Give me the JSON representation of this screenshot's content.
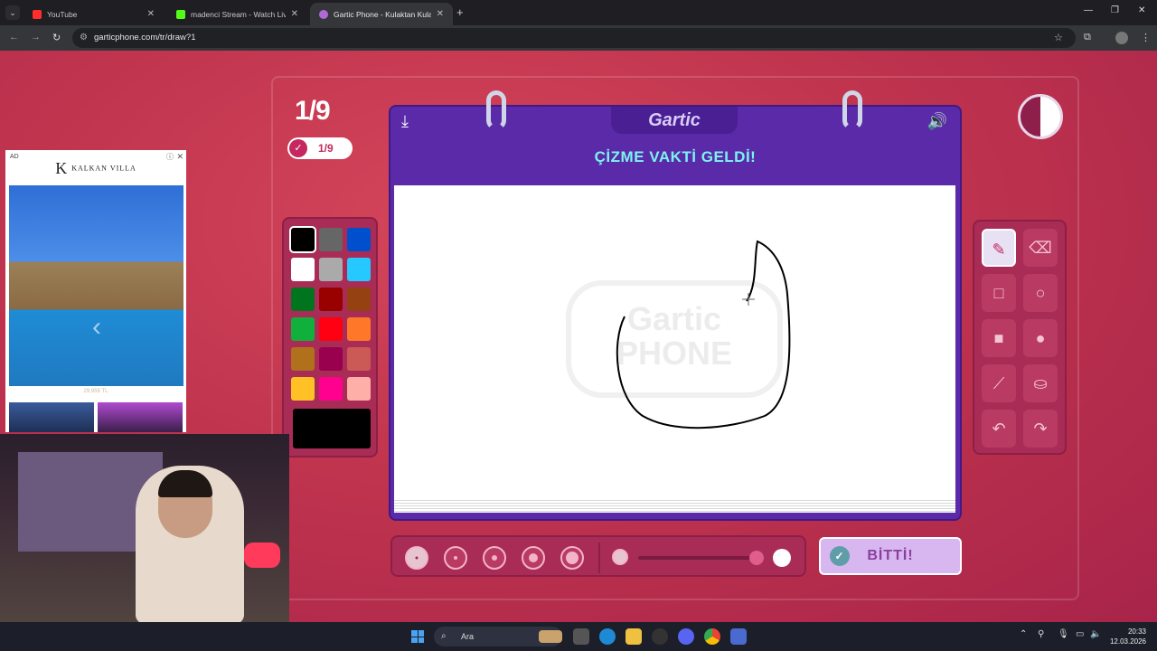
{
  "browser": {
    "tabs": [
      {
        "label": "YouTube",
        "favicon_color": "#ff2d2d"
      },
      {
        "label": "madenci Stream - Watch Live o",
        "favicon_color": "#53fc18"
      },
      {
        "label": "Gartic Phone - Kulaktan Kulağa",
        "favicon_color": "#b06ad8"
      }
    ],
    "url": "garticphone.com/tr/draw?1"
  },
  "game": {
    "round": "1/9",
    "round_badge": "1/9",
    "logo": "Gartic",
    "headline": "ÇİZME VAKTİ GELDİ!",
    "watermark_line1": "Gartic",
    "watermark_line2": "PHONE",
    "done_label": "BİTTİ!",
    "palette": [
      "#000000",
      "#666666",
      "#0050cd",
      "#ffffff",
      "#aaaaaa",
      "#26c9ff",
      "#017420",
      "#990000",
      "#964112",
      "#11b03c",
      "#ff0013",
      "#ff7829",
      "#b0701c",
      "#99004e",
      "#cb5a57",
      "#ffc126",
      "#ff008f",
      "#feafa8"
    ],
    "selected_color": "#000000",
    "tools": [
      "pen-icon",
      "eraser-icon",
      "rectangle-outline-icon",
      "ellipse-outline-icon",
      "rectangle-fill-icon",
      "ellipse-fill-icon",
      "line-icon",
      "bucket-icon",
      "undo-icon",
      "redo-icon"
    ],
    "selected_tool": "pen-icon",
    "brush_sizes": 5,
    "selected_brush_size": 1,
    "opacity_level": 1.0
  },
  "ad": {
    "tag": "AD",
    "brand": "KALKAN VILLA",
    "price": "29,959 TL"
  },
  "taskbar": {
    "search_placeholder": "Ara",
    "time": "20:33",
    "date": "12.03.2026"
  }
}
